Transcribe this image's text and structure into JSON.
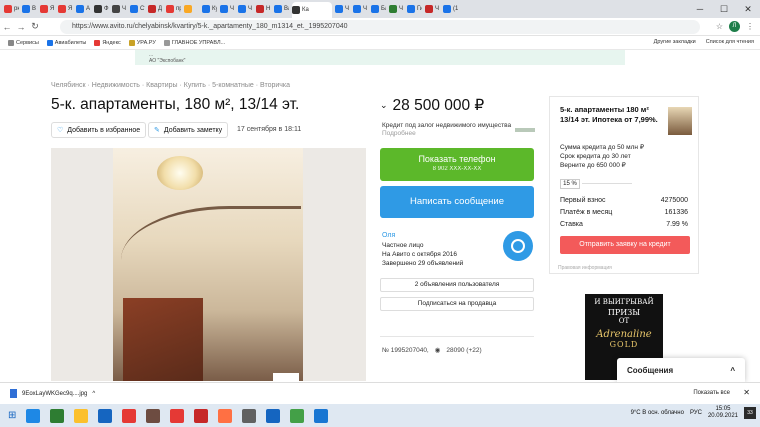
{
  "browser": {
    "tabs": [
      {
        "label": "рк",
        "color": "#e53935"
      },
      {
        "label": "В",
        "color": "#1a73e8"
      },
      {
        "label": "Я",
        "color": "#e53935"
      },
      {
        "label": "Я",
        "color": "#e53935"
      },
      {
        "label": "А",
        "color": "#1a73e8"
      },
      {
        "label": "Ф",
        "color": "#333333"
      },
      {
        "label": "Ч",
        "color": "#444444"
      },
      {
        "label": "Ст",
        "color": "#1a73e8"
      },
      {
        "label": "Д",
        "color": "#c62828"
      },
      {
        "label": "пр",
        "color": "#e53935"
      },
      {
        "label": "",
        "color": "#f9a825"
      },
      {
        "label": "Ку",
        "color": "#1a73e8"
      },
      {
        "label": "Ч",
        "color": "#1a73e8"
      },
      {
        "label": "Ч",
        "color": "#1a73e8"
      },
      {
        "label": "Н",
        "color": "#c62828"
      },
      {
        "label": "Ва",
        "color": "#1a73e8"
      },
      {
        "label": "Ка",
        "color": "#333333"
      },
      {
        "label": "Ч",
        "color": "#1a73e8"
      },
      {
        "label": "Ч",
        "color": "#1a73e8"
      },
      {
        "label": "Ба",
        "color": "#1a73e8"
      },
      {
        "label": "Ч",
        "color": "#2e7d32"
      },
      {
        "label": "Ги",
        "color": "#1a73e8"
      },
      {
        "label": "Ч",
        "color": "#c62828"
      },
      {
        "label": "(1",
        "color": "#1a73e8"
      }
    ],
    "url": "https://www.avito.ru/chelyabinsk/kvartiry/5-k._apartamenty_180_m1314_et._1995207040",
    "profile_initial": "Л",
    "window_controls": [
      "─",
      "☐",
      "✕"
    ],
    "bookmarks": [
      "Сервисы",
      "Авиабилеты",
      "Яндекс",
      "УРА.РУ",
      "ГЛАВНОЕ УПРАВЛ..."
    ],
    "bookmarks_right": [
      "Другие закладки",
      "Список для чтения"
    ]
  },
  "banner": {
    "line1": "...",
    "line2": "АО \"Экспобанк\""
  },
  "listing": {
    "breadcrumbs": "Челябинск · Недвижимость · Квартиры · Купить · 5-комнатные · Вторичка",
    "title": "5-к. апартаменты, 180 м², 13/14 эт.",
    "favorite_label": "Добавить в избранное",
    "note_label": "Добавить заметку",
    "date": "17 сентября в 18:11",
    "price": "28 500 000 ₽",
    "credit_note": "Кредит под залог недвижимого имущества",
    "credit_more": "Подробнее",
    "phone_button": "Показать телефон",
    "phone_masked": "8 902 XXX-XX-XX",
    "message_button": "Написать сообщение",
    "seller": {
      "name": "Оля",
      "type": "Частное лицо",
      "since": "На Авито с октября 2016",
      "completed": "Завершено 29 объявлений"
    },
    "user_ads_button": "2 объявления пользователя",
    "subscribe_button": "Подписаться на продавца",
    "ad_number": "№ 1995207040,",
    "views": "28090 (+22)"
  },
  "mortgage": {
    "title": "5-к. апартаменты 180 м² 13/14 эт. Ипотека от 7,99%.",
    "terms": [
      "Сумма кредита до 50 млн ₽",
      "Срок кредита до 30 лет",
      "Верните до 650 000 ₽"
    ],
    "rate_option": "15 %",
    "rows": [
      {
        "label": "Первый взнос",
        "value": "4275000"
      },
      {
        "label": "Платёж в месяц",
        "value": "161336"
      },
      {
        "label": "Ставка",
        "value": "7.99 %"
      }
    ],
    "submit": "Отправить заявку на кредит",
    "footer": "Правовая информация"
  },
  "ad_banner": {
    "l1": "И ВЫИГРЫВАЙ",
    "l2": "ПРИЗЫ",
    "l3": "ОТ",
    "l4": "Adrenaline",
    "l5": "GOLD"
  },
  "messages": {
    "label": "Сообщения",
    "chevron": "^"
  },
  "downloads": {
    "file": "9EoxLayWKGec9q....jpg",
    "show_all": "Показать все",
    "close": "✕"
  },
  "taskbar": {
    "icons": [
      "#1e88e5",
      "#2e7d32",
      "#fbc02d",
      "#1565c0",
      "#e53935",
      "#6d4c41",
      "#e53935",
      "#c62828",
      "#ff7043",
      "#616161",
      "#1565c0",
      "#43a047",
      "#1976d2"
    ],
    "weather": "9°C В осн. облачно",
    "lang": "РУС",
    "time": "15:05",
    "date": "20.09.2021",
    "notif": "33"
  }
}
